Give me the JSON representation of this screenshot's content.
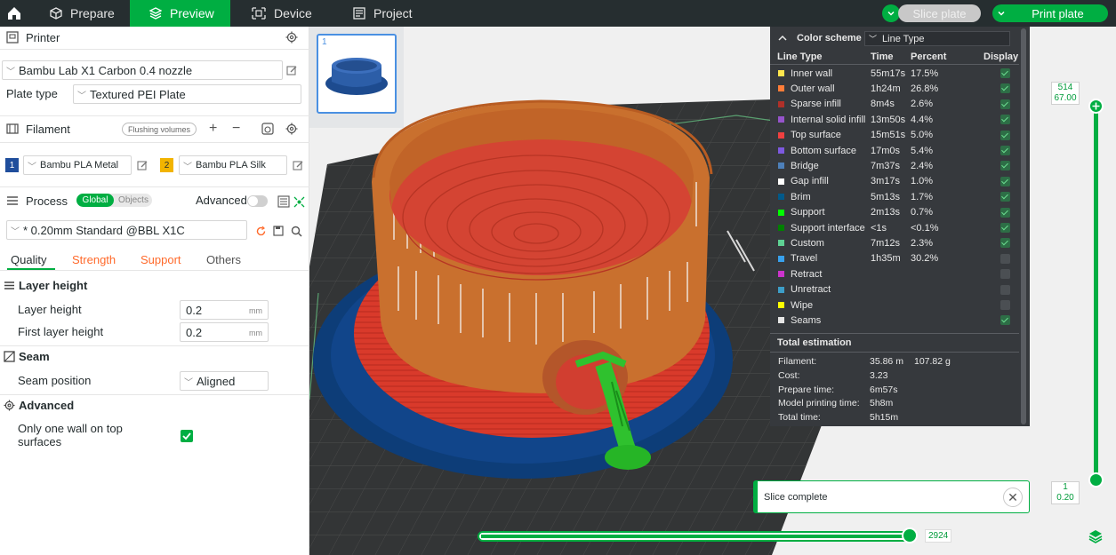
{
  "topbar": {
    "tabs": [
      {
        "label": "Prepare",
        "icon": "cube-icon"
      },
      {
        "label": "Preview",
        "icon": "layers-icon"
      },
      {
        "label": "Device",
        "icon": "device-icon"
      },
      {
        "label": "Project",
        "icon": "project-icon"
      }
    ],
    "active_tab": "Preview",
    "slice_label": "Slice plate",
    "print_label": "Print plate"
  },
  "printer": {
    "title": "Printer",
    "selected": "Bambu Lab X1 Carbon 0.4 nozzle",
    "plate_type_label": "Plate type",
    "plate_type": "Textured PEI Plate"
  },
  "filament": {
    "title": "Filament",
    "flushing_label": "Flushing volumes",
    "slots": [
      {
        "index": "1",
        "name": "Bambu PLA Metal",
        "color": "#1f4e9c"
      },
      {
        "index": "2",
        "name": "Bambu PLA Silk",
        "color": "#f2b400"
      }
    ]
  },
  "process": {
    "title": "Process",
    "global_label": "Global",
    "objects_label": "Objects",
    "advanced_label": "Advanced",
    "preset": "* 0.20mm Standard @BBL X1C",
    "tabs": [
      "Quality",
      "Strength",
      "Support",
      "Others"
    ],
    "active_tab": "Quality"
  },
  "settings": {
    "layer_height_group": "Layer height",
    "layer_height_label": "Layer height",
    "layer_height_value": "0.2",
    "first_layer_label": "First layer height",
    "first_layer_value": "0.2",
    "unit": "mm",
    "seam_group": "Seam",
    "seam_position_label": "Seam position",
    "seam_position_value": "Aligned",
    "advanced_group": "Advanced",
    "one_wall_label_line1": "Only one wall on top",
    "one_wall_label_line2": "surfaces",
    "one_wall_checked": true
  },
  "thumbnail": {
    "index": "1"
  },
  "legend": {
    "title": "Color scheme",
    "scheme": "Line Type",
    "col_type": "Line Type",
    "col_time": "Time",
    "col_percent": "Percent",
    "col_display": "Display",
    "rows": [
      {
        "name": "Inner wall",
        "time": "55m17s",
        "percent": "17.5%",
        "color": "#ffe64d",
        "display": true
      },
      {
        "name": "Outer wall",
        "time": "1h24m",
        "percent": "26.8%",
        "color": "#ff7d38",
        "display": true
      },
      {
        "name": "Sparse infill",
        "time": "8m4s",
        "percent": "2.6%",
        "color": "#b03029",
        "display": true
      },
      {
        "name": "Internal solid infill",
        "time": "13m50s",
        "percent": "4.4%",
        "color": "#9654cc",
        "display": true
      },
      {
        "name": "Top surface",
        "time": "15m51s",
        "percent": "5.0%",
        "color": "#f04040",
        "display": true
      },
      {
        "name": "Bottom surface",
        "time": "17m0s",
        "percent": "5.4%",
        "color": "#7d59e0",
        "display": true
      },
      {
        "name": "Bridge",
        "time": "7m37s",
        "percent": "2.4%",
        "color": "#4d80ba",
        "display": true
      },
      {
        "name": "Gap infill",
        "time": "3m17s",
        "percent": "1.0%",
        "color": "#ffffff",
        "display": true
      },
      {
        "name": "Brim",
        "time": "5m13s",
        "percent": "1.7%",
        "color": "#00598a",
        "display": true
      },
      {
        "name": "Support",
        "time": "2m13s",
        "percent": "0.7%",
        "color": "#00ff00",
        "display": true
      },
      {
        "name": "Support interface",
        "time": "<1s",
        "percent": "<0.1%",
        "color": "#008000",
        "display": true
      },
      {
        "name": "Custom",
        "time": "7m12s",
        "percent": "2.3%",
        "color": "#5ed194",
        "display": true
      },
      {
        "name": "Travel",
        "time": "1h35m",
        "percent": "30.2%",
        "color": "#38a1ed",
        "display": false
      },
      {
        "name": "Retract",
        "time": "",
        "percent": "",
        "color": "#cc33cc",
        "display": false
      },
      {
        "name": "Unretract",
        "time": "",
        "percent": "",
        "color": "#3d9ec8",
        "display": false
      },
      {
        "name": "Wipe",
        "time": "",
        "percent": "",
        "color": "#ffff00",
        "display": false
      },
      {
        "name": "Seams",
        "time": "",
        "percent": "",
        "color": "#e6e6e6",
        "display": true
      }
    ],
    "estimation_title": "Total estimation",
    "estimation": [
      {
        "key": "Filament:",
        "value": "35.86 m",
        "extra": "107.82 g"
      },
      {
        "key": "Cost:",
        "value": "3.23",
        "extra": ""
      },
      {
        "key": "Prepare time:",
        "value": "6m57s",
        "extra": ""
      },
      {
        "key": "Model printing time:",
        "value": "5h8m",
        "extra": ""
      },
      {
        "key": "Total time:",
        "value": "5h15m",
        "extra": ""
      }
    ]
  },
  "vslider": {
    "top_layer": "514",
    "top_height": "67.00",
    "bottom_layer": "1",
    "bottom_height": "0.20"
  },
  "hslider": {
    "value": "2924"
  },
  "toast": {
    "message": "Slice complete"
  }
}
